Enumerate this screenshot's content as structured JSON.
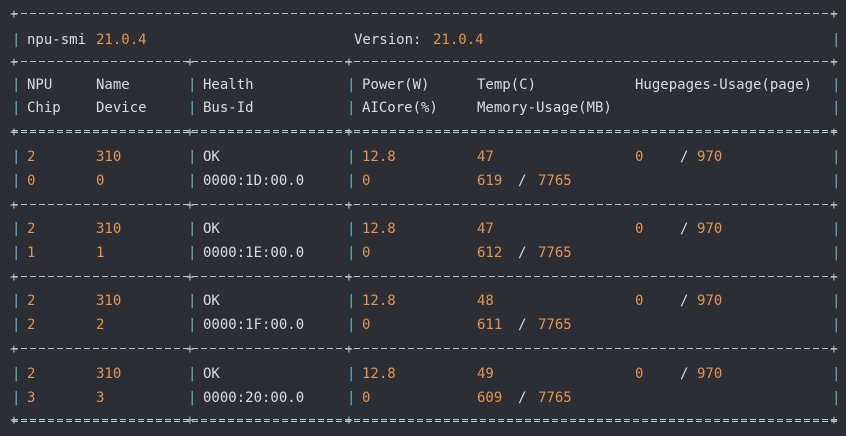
{
  "header": {
    "tool_name": "npu-smi",
    "tool_version": "21.0.4",
    "version_label": "Version:",
    "version_value": "21.0.4"
  },
  "columns": {
    "row1": [
      "NPU",
      "Name",
      "Health",
      "Power(W)",
      "Temp(C)",
      "Hugepages-Usage(page)"
    ],
    "row2": [
      "Chip",
      "Device",
      "Bus-Id",
      "AICore(%)",
      "Memory-Usage(MB)"
    ]
  },
  "devices": [
    {
      "npu": "2",
      "name": "310",
      "health": "OK",
      "power": "12.8",
      "temp": "47",
      "huge_used": "0",
      "huge_total": "970",
      "chip": "0",
      "device": "0",
      "bus_id": "0000:1D:00.0",
      "aicore": "0",
      "mem_used": "619",
      "mem_total": "7765"
    },
    {
      "npu": "2",
      "name": "310",
      "health": "OK",
      "power": "12.8",
      "temp": "47",
      "huge_used": "0",
      "huge_total": "970",
      "chip": "1",
      "device": "1",
      "bus_id": "0000:1E:00.0",
      "aicore": "0",
      "mem_used": "612",
      "mem_total": "7765"
    },
    {
      "npu": "2",
      "name": "310",
      "health": "OK",
      "power": "12.8",
      "temp": "48",
      "huge_used": "0",
      "huge_total": "970",
      "chip": "2",
      "device": "2",
      "bus_id": "0000:1F:00.0",
      "aicore": "0",
      "mem_used": "611",
      "mem_total": "7765"
    },
    {
      "npu": "2",
      "name": "310",
      "health": "OK",
      "power": "12.8",
      "temp": "49",
      "huge_used": "0",
      "huge_total": "970",
      "chip": "3",
      "device": "3",
      "bus_id": "0000:20:00.0",
      "aicore": "0",
      "mem_used": "609",
      "mem_total": "7765"
    }
  ],
  "colors": {
    "background": "#2b2f35",
    "text": "#d9dde3",
    "number": "#e8944b",
    "pipe": "#5fb7c9"
  }
}
